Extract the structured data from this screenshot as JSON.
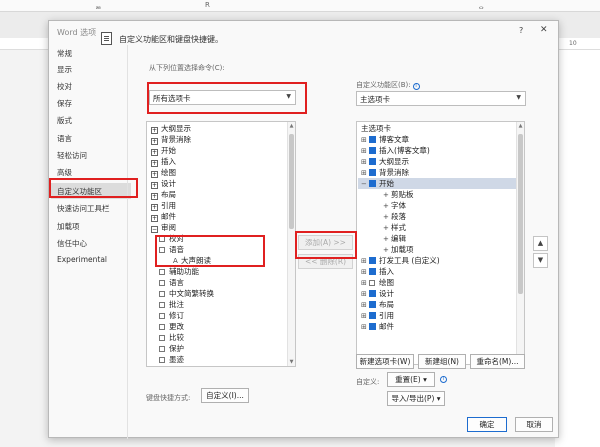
{
  "word_bg": {
    "topbar": [
      "ᆱ",
      "R",
      "ᆼ"
    ],
    "ruler_right": "10"
  },
  "dialog": {
    "title": "Word 选项",
    "help": "?",
    "close": "✕",
    "nav": [
      {
        "label": "常规",
        "selected": false
      },
      {
        "label": "显示",
        "selected": false
      },
      {
        "label": "校对",
        "selected": false
      },
      {
        "label": "保存",
        "selected": false
      },
      {
        "label": "版式",
        "selected": false
      },
      {
        "label": "语言",
        "selected": false
      },
      {
        "label": "轻松访问",
        "selected": false
      },
      {
        "label": "高级",
        "selected": false
      },
      {
        "label": "自定义功能区",
        "selected": true
      },
      {
        "label": "快速访问工具栏",
        "selected": false
      },
      {
        "label": "加载项",
        "selected": false
      },
      {
        "label": "信任中心",
        "selected": false
      },
      {
        "label": "Experimental",
        "selected": false
      }
    ],
    "header": "自定义功能区和键盘快捷键。",
    "left": {
      "from_label": "从下列位置选择命令(C):",
      "from_value": "所有选项卡",
      "items": [
        {
          "text": "大纲显示",
          "toggle": "+"
        },
        {
          "text": "背景消除",
          "toggle": "+"
        },
        {
          "text": "开始",
          "toggle": "+"
        },
        {
          "text": "插入",
          "toggle": "+"
        },
        {
          "text": "绘图",
          "toggle": "+"
        },
        {
          "text": "设计",
          "toggle": "+"
        },
        {
          "text": "布局",
          "toggle": "+"
        },
        {
          "text": "引用",
          "toggle": "+"
        },
        {
          "text": "邮件",
          "toggle": "+"
        },
        {
          "text": "审阅",
          "toggle": "-"
        },
        {
          "text": "校对",
          "toggle": "sub"
        },
        {
          "text": "语音",
          "toggle": "sub-"
        },
        {
          "text": "大声朗读",
          "toggle": "leaf"
        },
        {
          "text": "辅助功能",
          "toggle": "sub"
        },
        {
          "text": "语言",
          "toggle": "sub"
        },
        {
          "text": "中文简繁转换",
          "toggle": "sub"
        },
        {
          "text": "批注",
          "toggle": "sub"
        },
        {
          "text": "修订",
          "toggle": "sub"
        },
        {
          "text": "更改",
          "toggle": "sub"
        },
        {
          "text": "比较",
          "toggle": "sub"
        },
        {
          "text": "保护",
          "toggle": "sub"
        },
        {
          "text": "墨迹",
          "toggle": "sub"
        },
        {
          "text": "视图",
          "toggle": "+"
        },
        {
          "text": "开发工具",
          "toggle": "+"
        }
      ],
      "shortcuts_label": "键盘快捷方式:",
      "customize_btn": "自定义(I)..."
    },
    "mid": {
      "add_btn": "添加(A) >>",
      "remove_btn": "<< 删除(R)"
    },
    "right": {
      "label": "自定义功能区(B):",
      "value": "主选项卡",
      "items": [
        {
          "text": "主选项卡",
          "kind": "header"
        },
        {
          "text": "博客文章",
          "kind": "tab"
        },
        {
          "text": "插入(博客文章)",
          "kind": "tab"
        },
        {
          "text": "大纲显示",
          "kind": "tab"
        },
        {
          "text": "背景消除",
          "kind": "tab"
        },
        {
          "text": "开始",
          "kind": "tab-open"
        },
        {
          "text": "剪贴板",
          "kind": "group"
        },
        {
          "text": "字体",
          "kind": "group"
        },
        {
          "text": "段落",
          "kind": "group"
        },
        {
          "text": "样式",
          "kind": "group"
        },
        {
          "text": "编辑",
          "kind": "group"
        },
        {
          "text": "加载项",
          "kind": "group"
        },
        {
          "text": "打发工具 (自定义)",
          "kind": "tab"
        },
        {
          "text": "插入",
          "kind": "tab"
        },
        {
          "text": "绘图",
          "kind": "tab-unchecked"
        },
        {
          "text": "设计",
          "kind": "tab"
        },
        {
          "text": "布局",
          "kind": "tab"
        },
        {
          "text": "引用",
          "kind": "tab"
        },
        {
          "text": "邮件",
          "kind": "tab"
        }
      ],
      "new_tab_btn": "新建选项卡(W)",
      "new_group_btn": "新建组(N)",
      "rename_btn": "重命名(M)...",
      "custom_label": "自定义:",
      "reset_btn": "重置(E) ▾",
      "import_btn": "导入/导出(P) ▾"
    },
    "ok_btn": "确定",
    "cancel_btn": "取消"
  }
}
